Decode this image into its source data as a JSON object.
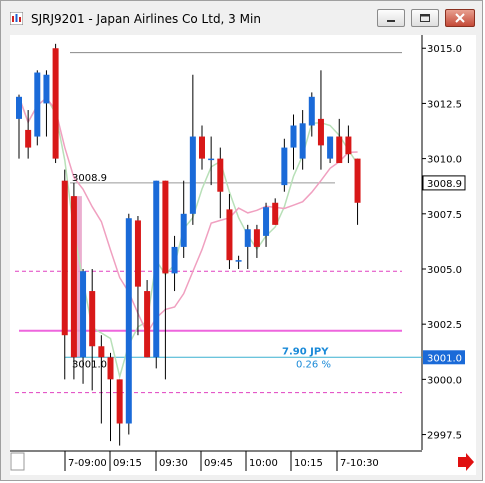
{
  "window": {
    "title": "SJRJ9201 - Japan Airlines Co Ltd, 3 Min"
  },
  "chart_data": {
    "type": "candlestick",
    "y_ticks": [
      "3015.0",
      "3012.5",
      "3010.0",
      "3007.5",
      "3005.0",
      "3002.5",
      "3000.0",
      "2997.5"
    ],
    "x_ticks": [
      "7-09:00",
      "09:15",
      "09:30",
      "09:45",
      "10:00",
      "10:15",
      "7-10:30"
    ],
    "last_price": "3008.9",
    "marker_price": "3001.0",
    "marker_line_price_label": "3008.9",
    "marker_line_low_label": "3001.0",
    "range_value": "7.90 JPY",
    "range_percent": "0.26 %",
    "ylim": [
      2996.8,
      3015.6
    ],
    "candles": [
      {
        "o": 3011.8,
        "h": 3012.9,
        "l": 3010.0,
        "c": 3012.8
      },
      {
        "o": 3011.3,
        "h": 3012.2,
        "l": 3010.0,
        "c": 3010.5
      },
      {
        "o": 3011.0,
        "h": 3014.0,
        "l": 3010.6,
        "c": 3013.9
      },
      {
        "o": 3012.5,
        "h": 3014.0,
        "l": 3011.0,
        "c": 3013.8
      },
      {
        "o": 3015.0,
        "h": 3015.2,
        "l": 3009.8,
        "c": 3010.0
      },
      {
        "o": 3009.0,
        "h": 3009.5,
        "l": 3000.0,
        "c": 3002.0
      },
      {
        "o": 3008.3,
        "h": 3008.9,
        "l": 3000.0,
        "c": 3001.0
      },
      {
        "o": 3001.0,
        "h": 3005.0,
        "l": 2999.8,
        "c": 3004.9
      },
      {
        "o": 3004.0,
        "h": 3005.0,
        "l": 2999.5,
        "c": 3001.5
      },
      {
        "o": 3001.5,
        "h": 3002.0,
        "l": 2998.0,
        "c": 3001.0
      },
      {
        "o": 3001.0,
        "h": 3001.2,
        "l": 2997.2,
        "c": 3000.0
      },
      {
        "o": 3000.0,
        "h": 3000.0,
        "l": 2997.0,
        "c": 2998.0
      },
      {
        "o": 2998.0,
        "h": 3007.5,
        "l": 2997.5,
        "c": 3007.3
      },
      {
        "o": 3007.2,
        "h": 3007.4,
        "l": 3002.0,
        "c": 3004.2
      },
      {
        "o": 3004.0,
        "h": 3004.5,
        "l": 3001.0,
        "c": 3001.0
      },
      {
        "o": 3001.0,
        "h": 3009.0,
        "l": 3000.5,
        "c": 3009.0
      },
      {
        "o": 3009.0,
        "h": 3009.0,
        "l": 3000.0,
        "c": 3004.8
      },
      {
        "o": 3004.8,
        "h": 3006.5,
        "l": 3004.0,
        "c": 3006.0
      },
      {
        "o": 3006.0,
        "h": 3009.0,
        "l": 3005.5,
        "c": 3007.5
      },
      {
        "o": 3007.5,
        "h": 3013.8,
        "l": 3007.0,
        "c": 3011.0
      },
      {
        "o": 3011.0,
        "h": 3011.5,
        "l": 3009.5,
        "c": 3010.0
      },
      {
        "o": 3010.0,
        "h": 3011.0,
        "l": 3008.8,
        "c": 3010.0
      },
      {
        "o": 3010.0,
        "h": 3010.5,
        "l": 3007.3,
        "c": 3008.5
      },
      {
        "o": 3007.7,
        "h": 3008.4,
        "l": 3005.0,
        "c": 3005.4
      },
      {
        "o": 3005.4,
        "h": 3005.6,
        "l": 3005.0,
        "c": 3005.4
      },
      {
        "o": 3006.0,
        "h": 3007.0,
        "l": 3005.0,
        "c": 3006.8
      },
      {
        "o": 3006.8,
        "h": 3007.0,
        "l": 3005.5,
        "c": 3006.0
      },
      {
        "o": 3006.5,
        "h": 3008.0,
        "l": 3006.0,
        "c": 3007.8
      },
      {
        "o": 3008.0,
        "h": 3008.2,
        "l": 3007.0,
        "c": 3007.0
      },
      {
        "o": 3008.8,
        "h": 3010.9,
        "l": 3008.5,
        "c": 3010.5
      },
      {
        "o": 3010.5,
        "h": 3012.0,
        "l": 3009.5,
        "c": 3011.5
      },
      {
        "o": 3010.0,
        "h": 3012.2,
        "l": 3009.5,
        "c": 3011.6
      },
      {
        "o": 3011.5,
        "h": 3013.0,
        "l": 3011.0,
        "c": 3012.8
      },
      {
        "o": 3011.8,
        "h": 3014.0,
        "l": 3009.5,
        "c": 3010.6
      },
      {
        "o": 3010.0,
        "h": 3011.0,
        "l": 3009.8,
        "c": 3011.0
      },
      {
        "o": 3011.0,
        "h": 3011.8,
        "l": 3009.8,
        "c": 3009.8
      },
      {
        "o": 3011.0,
        "h": 3011.5,
        "l": 3009.8,
        "c": 3010.2
      },
      {
        "o": 3010.0,
        "h": 3010.0,
        "l": 3007.0,
        "c": 3008.0
      }
    ],
    "dashed_levels": [
      3004.9,
      2999.4
    ],
    "solid_magenta_level": 3002.2,
    "top_gray_level": 3014.8
  }
}
